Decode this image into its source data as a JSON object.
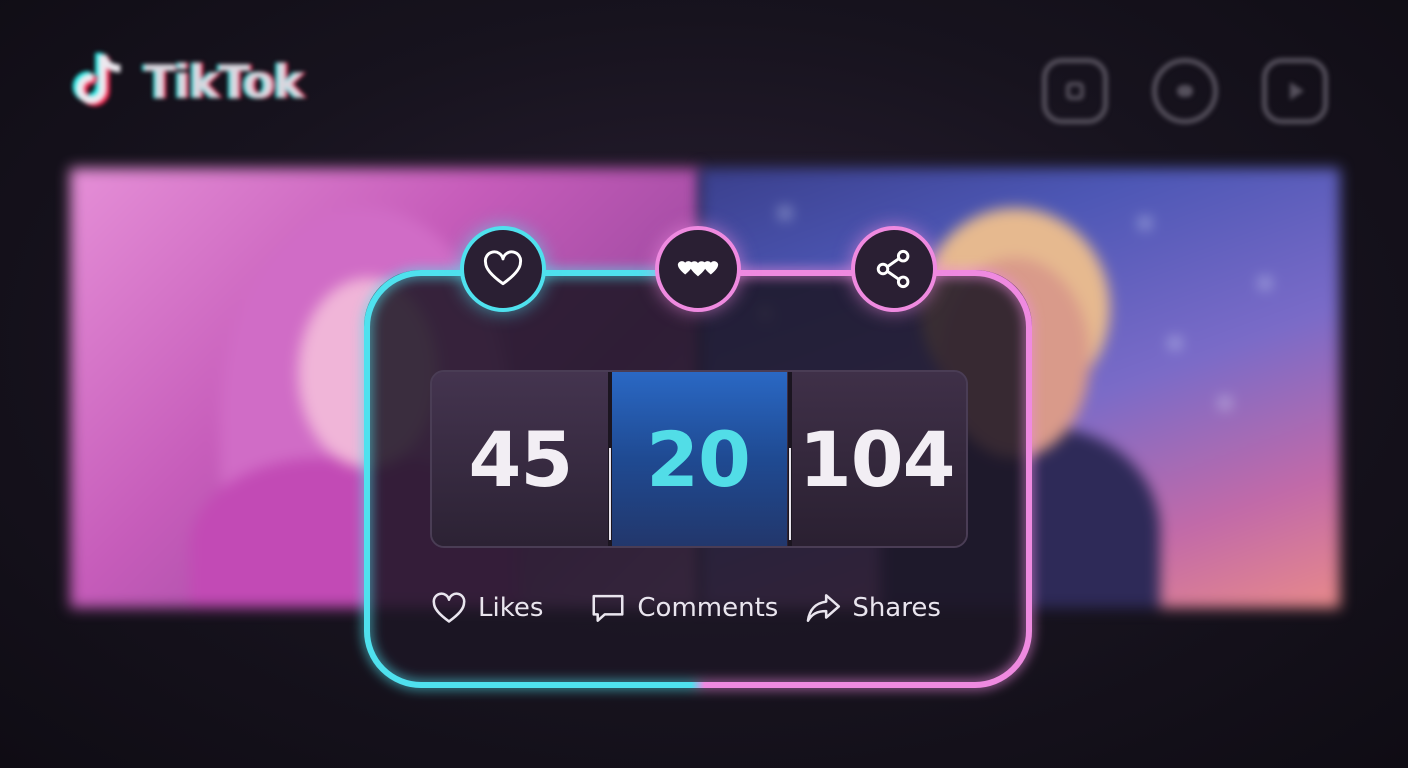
{
  "app": {
    "brand": "TikTok"
  },
  "header": {
    "icons": [
      "camera-icon",
      "chat-bubble-icon",
      "video-icon"
    ]
  },
  "metrics_card": {
    "badges": [
      "heart-icon",
      "hearts-icon",
      "share-icon"
    ],
    "values": [
      "45",
      "20",
      "104"
    ],
    "labels": {
      "likes": "Likes",
      "comments": "Comments",
      "shares": "Shares"
    },
    "highlighted_index": 1
  },
  "colors": {
    "accent_cyan": "#4fe1ee",
    "accent_pink": "#ef8ae0",
    "highlight_blue": "#2a68c4",
    "value_highlight": "#52dde7",
    "tiktok_cyan": "#25f4ee",
    "tiktok_red": "#fe2c55"
  }
}
